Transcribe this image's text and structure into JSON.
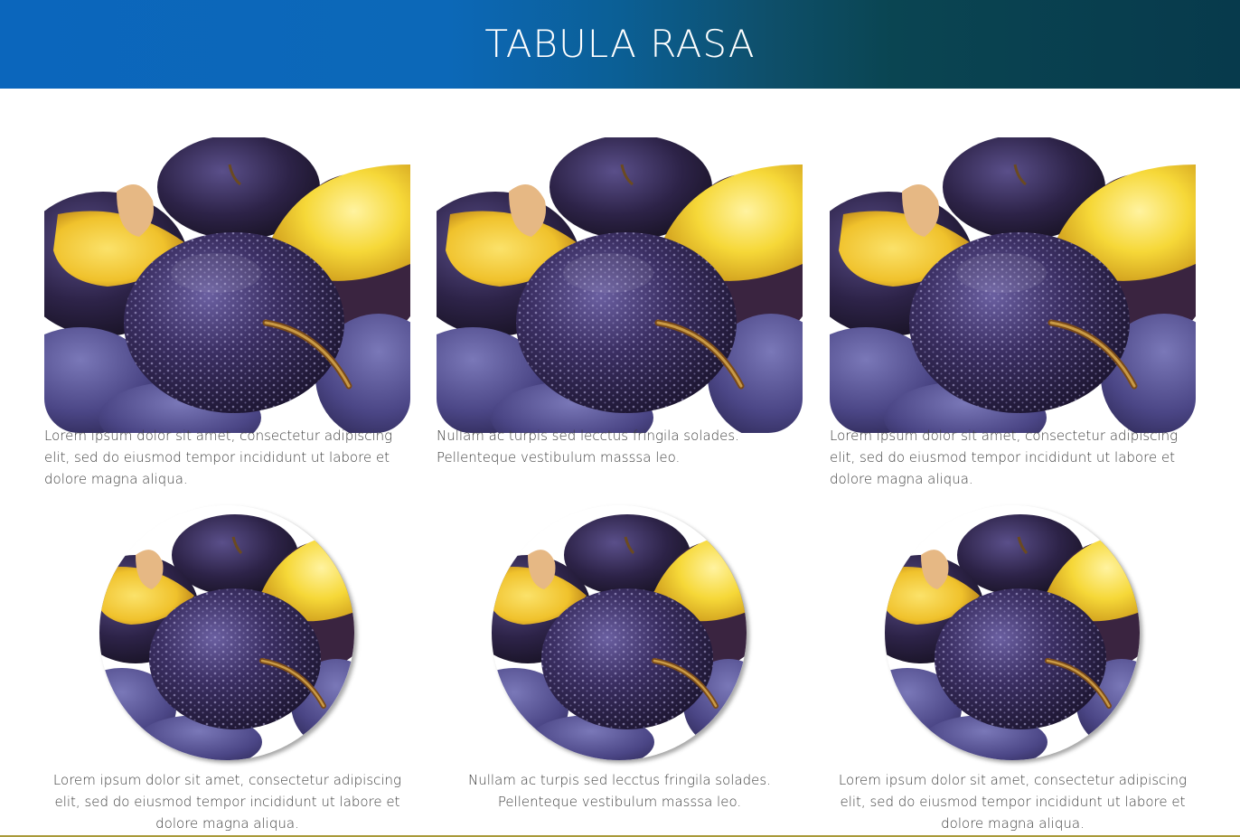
{
  "header": {
    "title": "TABULA RASA"
  },
  "cards_top": [
    {
      "text": "Lorem ipsum dolor sit amet, consectetur adipiscing elit, sed do eiusmod tempor incididunt ut labore et dolore magna aliqua."
    },
    {
      "text": "Nullam ac turpis sed lecctus fringila solades. Pellenteque vestibulum masssa leo."
    },
    {
      "text": "Lorem ipsum dolor sit amet, consectetur adipiscing elit, sed do eiusmod tempor incididunt ut labore et dolore magna aliqua."
    }
  ],
  "cards_bottom": [
    {
      "text": "Lorem ipsum dolor sit amet, consectetur adipiscing elit, sed do eiusmod tempor incididunt ut labore et dolore magna aliqua."
    },
    {
      "text": "Nullam ac turpis sed lecctus fringila solades. Pellenteque vestibulum masssa leo."
    },
    {
      "text": "Lorem ipsum dolor sit amet, consectetur adipiscing elit, sed do eiusmod tempor incididunt ut labore et dolore magna aliqua."
    }
  ],
  "colors": {
    "header_left": "#0b66bc",
    "header_right": "#073a4c",
    "text": "#3e3e3e",
    "plum_dark": "#2e2344",
    "plum_mid": "#4a3d78",
    "plum_flesh": "#f4d43a"
  },
  "images": {
    "photo_subject": "plums-photo"
  }
}
